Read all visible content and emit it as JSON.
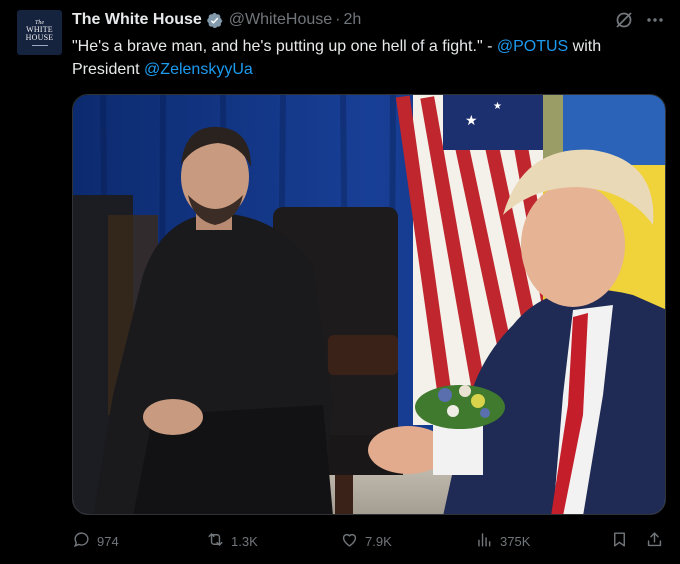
{
  "tweet": {
    "author": {
      "name": "The White House",
      "handle": "@WhiteHouse",
      "time": "2h",
      "separator": "·",
      "avatar_lines": [
        "The",
        "WHITE",
        "HOUSE"
      ]
    },
    "text": {
      "quote": "\"He's a brave man, and he's putting up one hell of a fight.\" - ",
      "mention1": "@POTUS",
      "middle": " with President ",
      "mention2": "@ZelenskyyUa"
    },
    "actions": {
      "replies": "974",
      "reposts": "1.3K",
      "likes": "7.9K",
      "views": "375K"
    },
    "icons": [
      "verified-badge-icon",
      "grok-icon",
      "more-icon",
      "reply-icon",
      "repost-icon",
      "like-icon",
      "views-icon",
      "bookmark-icon",
      "share-icon"
    ],
    "colors": {
      "background": "#000000",
      "text": "#e7e9ea",
      "muted": "#71767b",
      "link": "#1d9bf0"
    }
  }
}
